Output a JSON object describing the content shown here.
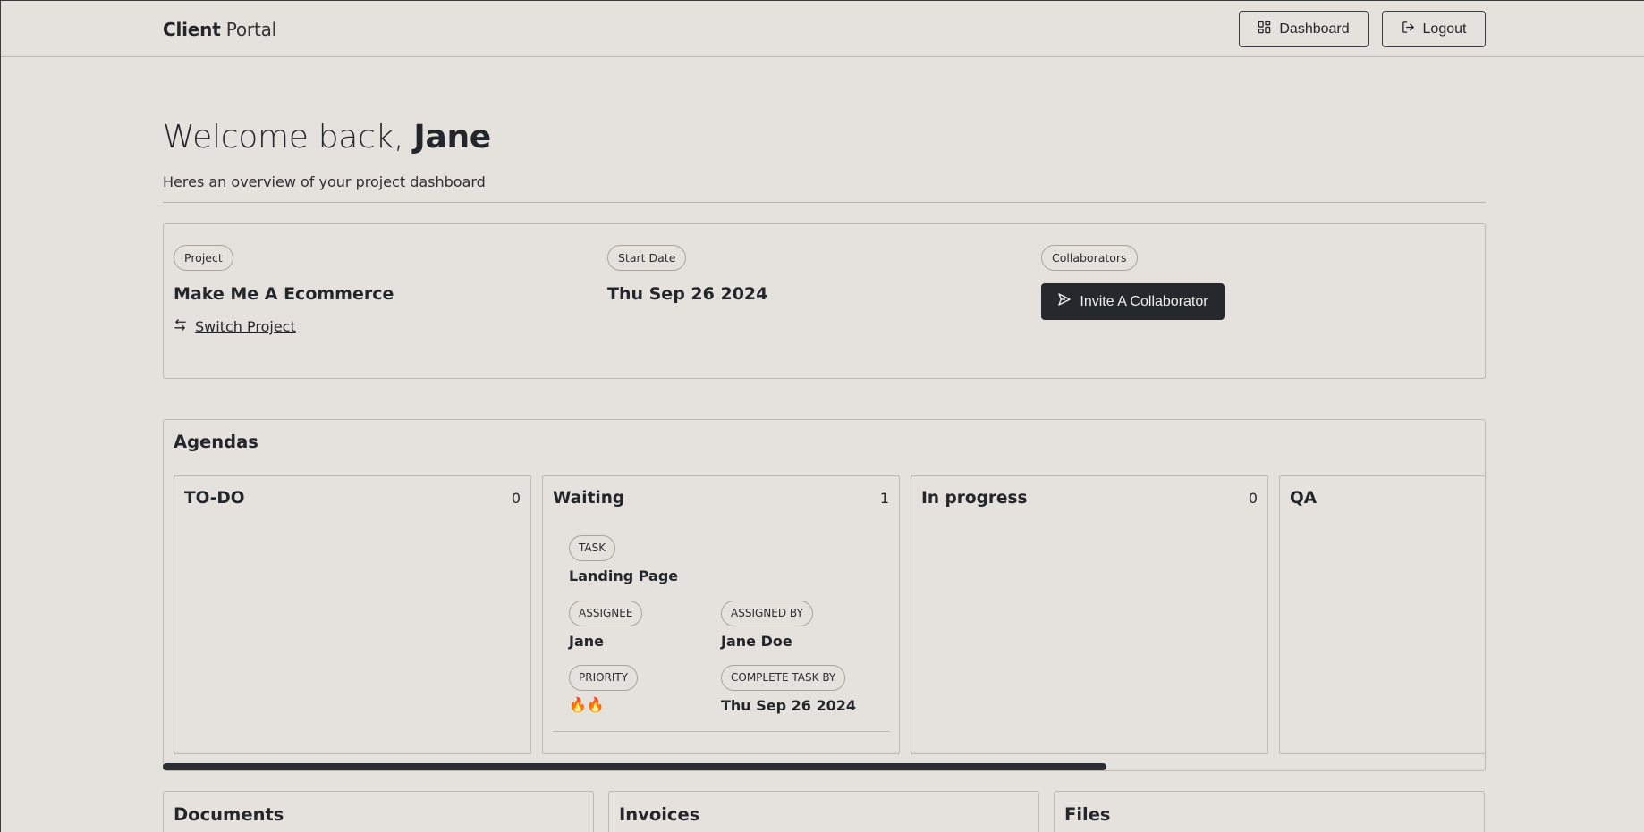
{
  "header": {
    "brand_bold": "Client",
    "brand_light": "Portal",
    "dashboard_label": "Dashboard",
    "logout_label": "Logout"
  },
  "welcome": {
    "greeting": "Welcome back, ",
    "name": "Jane",
    "subtitle": "Heres an overview of your project dashboard"
  },
  "project": {
    "project_label": "Project",
    "project_name": "Make Me A Ecommerce",
    "switch_label": "Switch Project",
    "start_label": "Start Date",
    "start_date": "Thu Sep 26 2024",
    "collab_label": "Collaborators",
    "invite_label": "Invite A Collaborator"
  },
  "agendas": {
    "title": "Agendas",
    "columns": [
      {
        "title": "TO-DO",
        "count": "0"
      },
      {
        "title": "Waiting",
        "count": "1"
      },
      {
        "title": "In progress",
        "count": "0"
      },
      {
        "title": "QA",
        "count": ""
      }
    ],
    "task": {
      "task_label": "TASK",
      "task_name": "Landing Page",
      "assignee_label": "ASSIGNEE",
      "assignee": "Jane",
      "assigned_by_label": "ASSIGNED BY",
      "assigned_by": "Jane Doe",
      "priority_label": "PRIORITY",
      "priority": "🔥🔥",
      "complete_by_label": "COMPLETE TASK BY",
      "complete_by": "Thu Sep 26 2024"
    }
  },
  "sections": {
    "documents": "Documents",
    "invoices": "Invoices",
    "files": "Files"
  }
}
